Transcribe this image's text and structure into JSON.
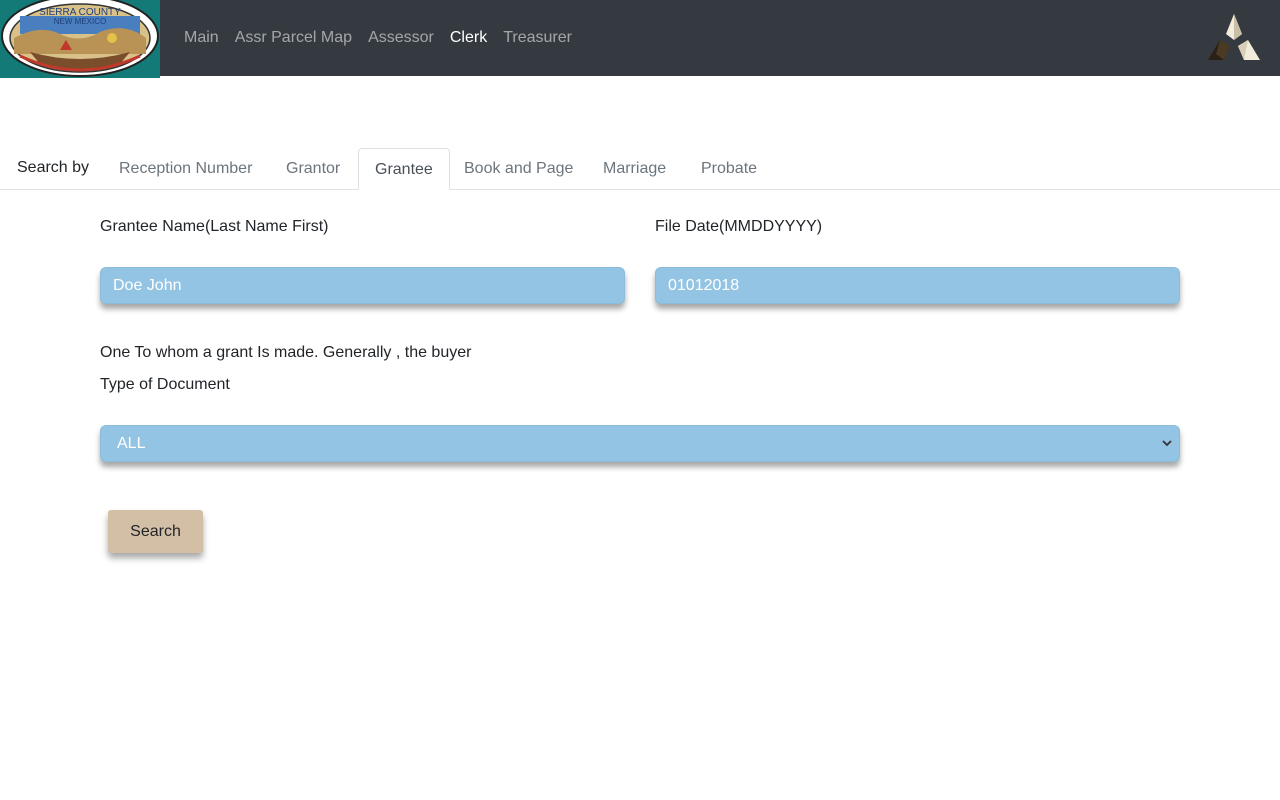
{
  "nav": {
    "logo_text_top": "SIERRA COUNTY",
    "logo_text_bottom": "NEW MEXICO",
    "links": [
      {
        "label": "Main"
      },
      {
        "label": "Assr Parcel Map"
      },
      {
        "label": "Assessor"
      },
      {
        "label": "Clerk",
        "active": true
      },
      {
        "label": "Treasurer"
      }
    ]
  },
  "tabs": {
    "prefix": "Search by",
    "items": [
      {
        "label": "Reception Number"
      },
      {
        "label": "Grantor"
      },
      {
        "label": "Grantee",
        "active": true
      },
      {
        "label": "Book and Page"
      },
      {
        "label": "Marriage"
      },
      {
        "label": "Probate"
      }
    ]
  },
  "form": {
    "grantee_label": "Grantee Name(Last Name First)",
    "grantee_value": "Doe John",
    "date_label": "File Date(MMDDYYYY)",
    "date_value": "01012018",
    "definition": "One To whom a grant Is made. Generally , the buyer",
    "doc_type_label": "Type of Document",
    "doc_type_value": "ALL",
    "search_label": "Search"
  },
  "colors": {
    "navbar": "#343a40",
    "logo_bg": "#147a78",
    "input_bg": "#93c4e4",
    "button_bg": "#d3bfa6"
  },
  "icons": {
    "logo": "county-seal-icon",
    "brand": "pyramid-triangles-icon",
    "select_arrow": "chevron-down-icon"
  }
}
